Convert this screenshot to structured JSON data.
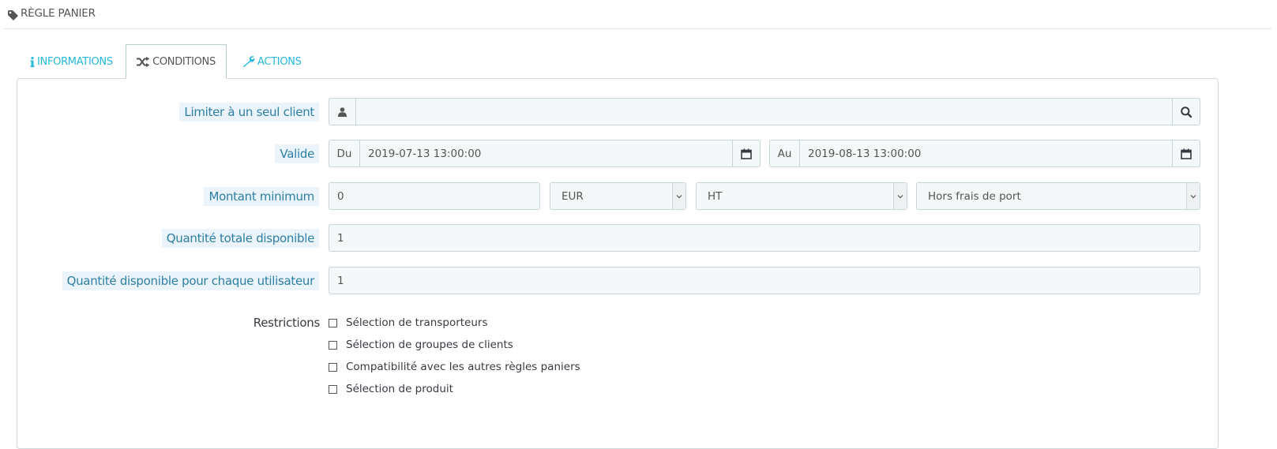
{
  "panel": {
    "title": "RÈGLE PANIER",
    "icon": "tag-icon"
  },
  "tabs": [
    {
      "label": "INFORMATIONS",
      "icon": "info-icon",
      "active": false
    },
    {
      "label": "CONDITIONS",
      "icon": "shuffle-icon",
      "active": true
    },
    {
      "label": "ACTIONS",
      "icon": "wrench-icon",
      "active": false
    }
  ],
  "form": {
    "customer": {
      "label": "Limiter à un seul client",
      "value": "",
      "icon_left": "user-icon",
      "icon_right": "search-icon"
    },
    "valid": {
      "label": "Valide",
      "from_prefix": "Du",
      "from_value": "2019-07-13 13:00:00",
      "to_prefix": "Au",
      "to_value": "2019-08-13 13:00:00",
      "icon": "calendar-icon"
    },
    "minimum": {
      "label": "Montant minimum",
      "amount": "0",
      "currency": "EUR",
      "tax": "HT",
      "shipping": "Hors frais de port"
    },
    "total_quantity": {
      "label": "Quantité totale disponible",
      "value": "1"
    },
    "per_user_quantity": {
      "label": "Quantité disponible pour chaque utilisateur",
      "value": "1"
    },
    "restrictions": {
      "label": "Restrictions",
      "items": [
        "Sélection de transporteurs",
        "Sélection de groupes de clients",
        "Compatibilité avec les autres règles paniers",
        "Sélection de produit"
      ]
    }
  },
  "colors": {
    "accent": "#25b9d7",
    "hint_bg": "#eaf4fa",
    "hint_text": "#2f7ea4",
    "input_bg": "#f5f8f9",
    "input_border": "#c7d6db"
  }
}
